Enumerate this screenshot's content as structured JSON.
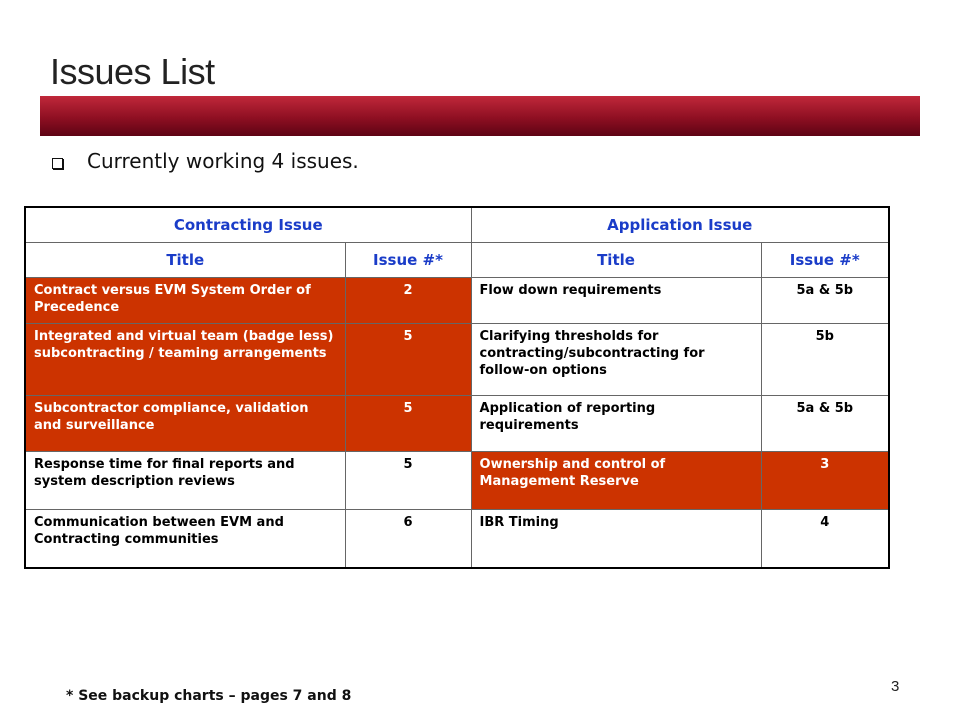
{
  "slide": {
    "title": "Issues List",
    "bullet": "Currently working 4 issues.",
    "footnote": "* See backup charts – pages 7 and 8",
    "page_number": "3"
  },
  "table": {
    "group_headers": [
      "Contracting Issue",
      "Application Issue"
    ],
    "column_headers": [
      "Title",
      "Issue #*",
      "Title",
      "Issue #*"
    ],
    "rows": [
      {
        "contracting_title": "Contract versus EVM System Order of Precedence",
        "contracting_issue": "2",
        "application_title": "Flow down requirements",
        "application_issue": "5a & 5b",
        "contracting_highlight": true,
        "application_highlight": false
      },
      {
        "contracting_title": "Integrated and virtual team (badge less)  subcontracting / teaming arrangements",
        "contracting_issue": "5",
        "application_title": "Clarifying thresholds for contracting/subcontracting for follow-on options",
        "application_issue": "5b",
        "contracting_highlight": true,
        "application_highlight": false
      },
      {
        "contracting_title": "Subcontractor  compliance, validation and surveillance",
        "contracting_issue": "5",
        "application_title": "Application of reporting requirements",
        "application_issue": "5a & 5b",
        "contracting_highlight": true,
        "application_highlight": false
      },
      {
        "contracting_title": "Response time for final reports and system description reviews",
        "contracting_issue": "5",
        "application_title": "Ownership and control of Management Reserve",
        "application_issue": "3",
        "contracting_highlight": false,
        "application_highlight": true
      },
      {
        "contracting_title": "Communication between EVM and Contracting communities",
        "contracting_issue": "6",
        "application_title": "IBR Timing",
        "application_issue": "4",
        "contracting_highlight": false,
        "application_highlight": false
      }
    ]
  },
  "colors": {
    "highlight": "#cc3300",
    "header_text": "#1a3cc8",
    "title_bar": "#8e0f22"
  }
}
